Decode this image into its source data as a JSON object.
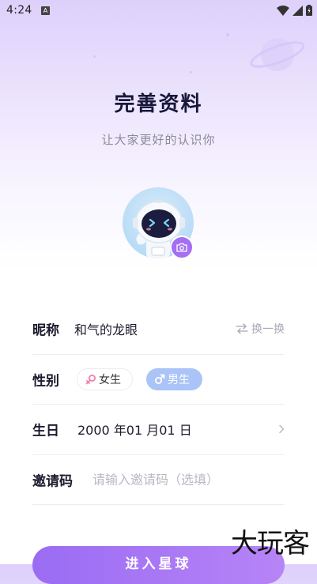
{
  "status_bar": {
    "time": "4:24",
    "notification_icon": "A"
  },
  "header": {
    "title": "完善资料",
    "subtitle": "让大家更好的认识你"
  },
  "form": {
    "nickname": {
      "label": "昵称",
      "value": "和气的龙眼",
      "shuffle_label": "换一换"
    },
    "gender": {
      "label": "性别",
      "options": [
        {
          "label": "女生",
          "selected": false
        },
        {
          "label": "男生",
          "selected": true
        }
      ]
    },
    "birthday": {
      "label": "生日",
      "value": "2000 年01 月01 日"
    },
    "invite": {
      "label": "邀请码",
      "placeholder": "请输入邀请码（选填）"
    }
  },
  "submit_label": "进入星球",
  "watermark": "大玩客",
  "colors": {
    "accent": "#a56ff1",
    "male_pill": "#abc4f7",
    "title": "#17173a"
  }
}
